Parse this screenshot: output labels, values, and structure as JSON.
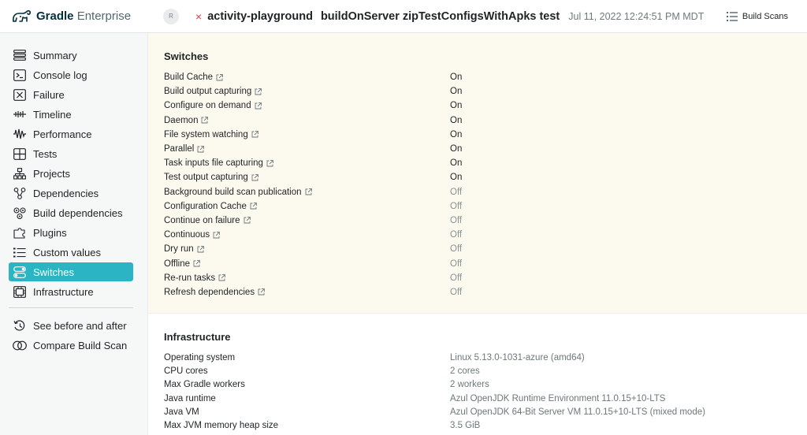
{
  "header": {
    "brand_strong": "Gradle",
    "brand_light": " Enterprise",
    "avatar": "R",
    "status_icon": "×",
    "project": "activity-playground",
    "tasks": "buildOnServer zipTestConfigsWithApks test",
    "timestamp": "Jul 11, 2022 12:24:51 PM MDT",
    "build_scans_label": "Build Scans",
    "status_color": "#e23d3d"
  },
  "sidebar": {
    "accent": "#2bb5c4",
    "items": [
      {
        "label": "Summary",
        "icon": "summary-icon"
      },
      {
        "label": "Console log",
        "icon": "console-icon"
      },
      {
        "label": "Failure",
        "icon": "failure-icon"
      },
      {
        "label": "Timeline",
        "icon": "timeline-icon"
      },
      {
        "label": "Performance",
        "icon": "performance-icon"
      },
      {
        "label": "Tests",
        "icon": "tests-icon"
      },
      {
        "label": "Projects",
        "icon": "projects-icon"
      },
      {
        "label": "Dependencies",
        "icon": "dependencies-icon"
      },
      {
        "label": "Build dependencies",
        "icon": "build-dependencies-icon"
      },
      {
        "label": "Plugins",
        "icon": "plugins-icon"
      },
      {
        "label": "Custom values",
        "icon": "custom-values-icon"
      },
      {
        "label": "Switches",
        "icon": "switches-icon"
      },
      {
        "label": "Infrastructure",
        "icon": "infrastructure-icon"
      }
    ],
    "secondary": [
      {
        "label": "See before and after",
        "icon": "history-icon"
      },
      {
        "label": "Compare Build Scan",
        "icon": "compare-icon"
      }
    ]
  },
  "switches": {
    "title": "Switches",
    "rows": [
      {
        "name": "Build Cache",
        "value": "On"
      },
      {
        "name": "Build output capturing",
        "value": "On"
      },
      {
        "name": "Configure on demand",
        "value": "On"
      },
      {
        "name": "Daemon",
        "value": "On"
      },
      {
        "name": "File system watching",
        "value": "On"
      },
      {
        "name": "Parallel",
        "value": "On"
      },
      {
        "name": "Task inputs file capturing",
        "value": "On"
      },
      {
        "name": "Test output capturing",
        "value": "On"
      },
      {
        "name": "Background build scan publication",
        "value": "Off"
      },
      {
        "name": "Configuration Cache",
        "value": "Off"
      },
      {
        "name": "Continue on failure",
        "value": "Off"
      },
      {
        "name": "Continuous",
        "value": "Off"
      },
      {
        "name": "Dry run",
        "value": "Off"
      },
      {
        "name": "Offline",
        "value": "Off"
      },
      {
        "name": "Re-run tasks",
        "value": "Off"
      },
      {
        "name": "Refresh dependencies",
        "value": "Off"
      }
    ]
  },
  "infrastructure": {
    "title": "Infrastructure",
    "rows": [
      {
        "name": "Operating system",
        "value": "Linux 5.13.0-1031-azure (amd64)"
      },
      {
        "name": "CPU cores",
        "value": "2 cores"
      },
      {
        "name": "Max Gradle workers",
        "value": "2 workers"
      },
      {
        "name": "Java runtime",
        "value": "Azul OpenJDK Runtime Environment 11.0.15+10-LTS"
      },
      {
        "name": "Java VM",
        "value": "Azul OpenJDK 64-Bit Server VM 11.0.15+10-LTS (mixed mode)"
      },
      {
        "name": "Max JVM memory heap size",
        "value": "3.5 GiB"
      }
    ]
  }
}
